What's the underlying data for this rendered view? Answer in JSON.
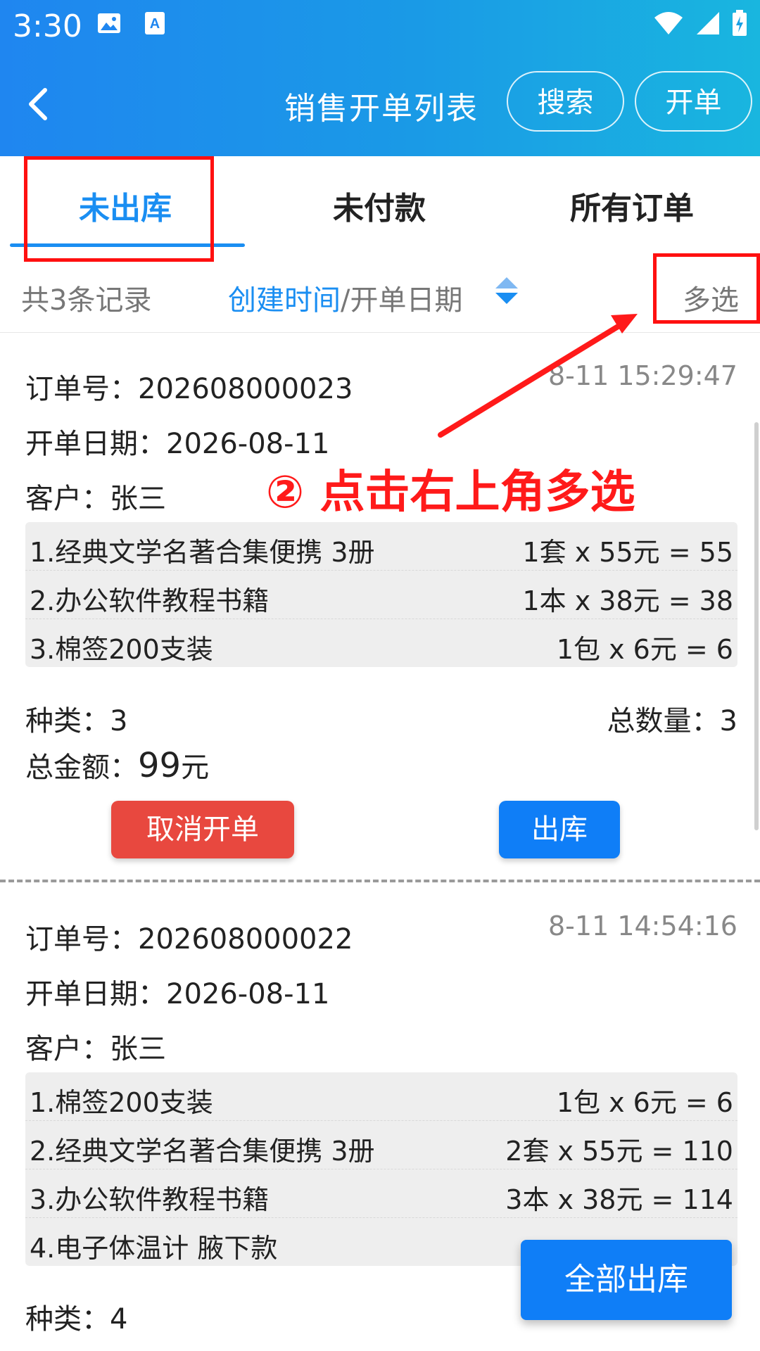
{
  "status_bar": {
    "time": "3:30"
  },
  "header": {
    "title": "销售开单列表",
    "search_label": "搜索",
    "open_label": "开单"
  },
  "tabs": [
    {
      "label": "未出库",
      "active": true
    },
    {
      "label": "未付款",
      "active": false
    },
    {
      "label": "所有订单",
      "active": false
    }
  ],
  "filter": {
    "record_count": "共3条记录",
    "sort_primary": "创建时间",
    "sort_secondary": "/开单日期",
    "multi_select": "多选"
  },
  "annotation": {
    "text": "② 点击右上角多选",
    "color": "#ff1a1a"
  },
  "orders": [
    {
      "order_no": "订单号：202608000023",
      "time": "8-11 15:29:47",
      "date": "开单日期：2026-08-11",
      "customer": "客户：张三",
      "items": [
        {
          "name": "1.经典文学名著合集便携 3册",
          "price": "1套 x 55元 = 55"
        },
        {
          "name": "2.办公软件教程书籍",
          "price": "1本 x 38元 = 38"
        },
        {
          "name": "3.棉签200支装",
          "price": "1包 x 6元 = 6"
        }
      ],
      "kinds": "种类：3",
      "quantity": "总数量：3",
      "amount_label": "总金额：",
      "amount_value": "99",
      "amount_unit": "元",
      "cancel_label": "取消开单",
      "ship_label": "出库"
    },
    {
      "order_no": "订单号：202608000022",
      "time": "8-11 14:54:16",
      "date": "开单日期：2026-08-11",
      "customer": "客户：张三",
      "items": [
        {
          "name": "1.棉签200支装",
          "price": "1包 x 6元 = 6"
        },
        {
          "name": "2.经典文学名著合集便携 3册",
          "price": "2套 x 55元 = 110"
        },
        {
          "name": "3.办公软件教程书籍",
          "price": "3本 x 38元 = 114"
        },
        {
          "name": "4.电子体温计 腋下款",
          "price": ""
        }
      ],
      "kinds": "种类：4"
    }
  ],
  "fab": {
    "label": "全部出库"
  },
  "colors": {
    "accent": "#1a8ef2",
    "cancel": "#e8483f",
    "ship": "#0f7ef7"
  }
}
